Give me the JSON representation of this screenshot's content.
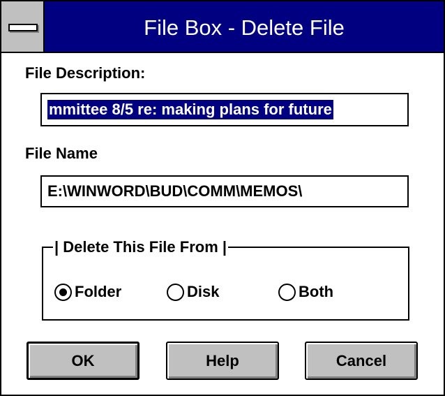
{
  "window": {
    "title": "File Box - Delete File"
  },
  "description": {
    "label": "File Description:",
    "value": "mmittee 8/5 re: making plans for future"
  },
  "filename": {
    "label": "File Name",
    "value": "E:\\WINWORD\\BUD\\COMM\\MEMOS\\"
  },
  "delete_from": {
    "label": "| Delete This File From |",
    "options": [
      {
        "label": "Folder",
        "selected": true
      },
      {
        "label": "Disk",
        "selected": false
      },
      {
        "label": "Both",
        "selected": false
      }
    ]
  },
  "buttons": {
    "ok": "OK",
    "help": "Help",
    "cancel": "Cancel"
  },
  "colors": {
    "title_bar": "#000080",
    "selection": "#000080",
    "button_face": "#c0c0c0"
  },
  "icons": {
    "system_menu": "system-menu-icon"
  }
}
